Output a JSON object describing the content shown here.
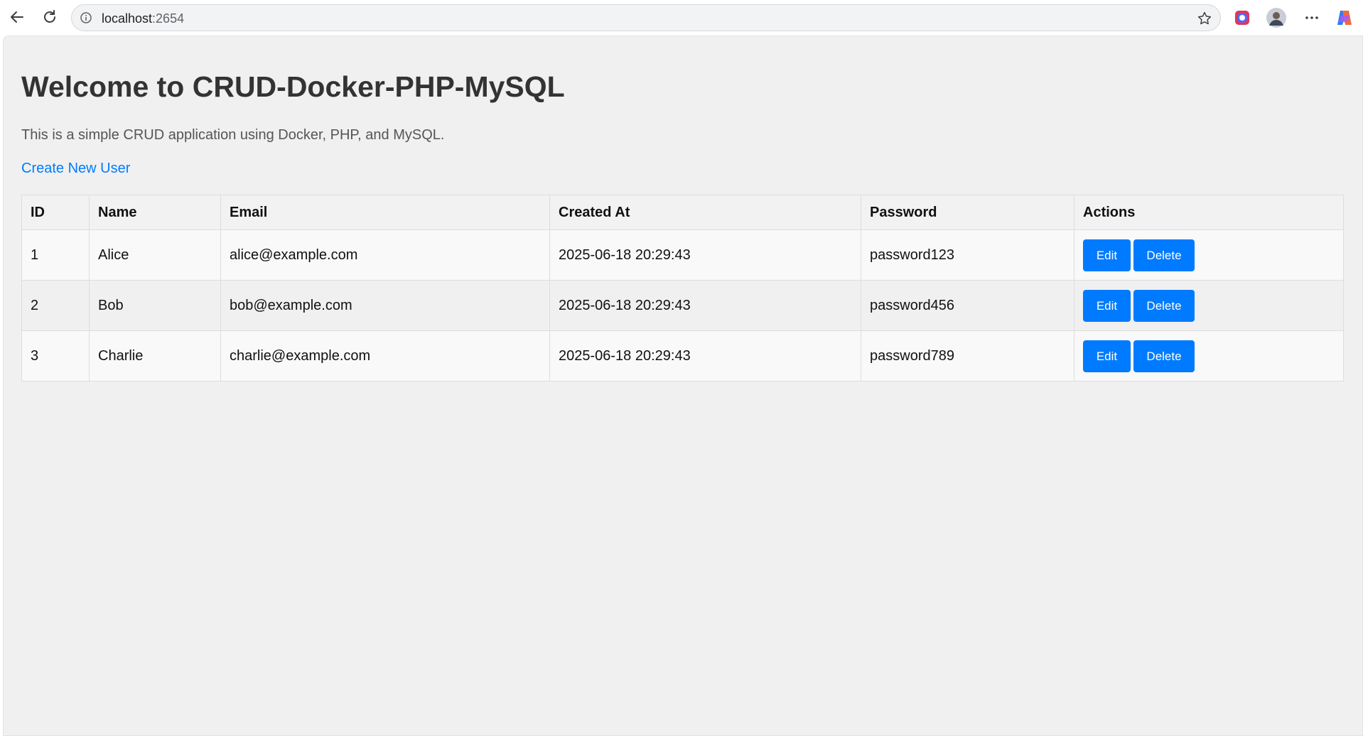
{
  "browser": {
    "url_host": "localhost",
    "url_port": ":2654"
  },
  "page": {
    "title": "Welcome to CRUD-Docker-PHP-MySQL",
    "subtitle": "This is a simple CRUD application using Docker, PHP, and MySQL.",
    "create_link": "Create New User"
  },
  "table": {
    "headers": [
      "ID",
      "Name",
      "Email",
      "Created At",
      "Password",
      "Actions"
    ],
    "rows": [
      {
        "id": "1",
        "name": "Alice",
        "email": "alice@example.com",
        "created_at": "2025-06-18 20:29:43",
        "password": "password123"
      },
      {
        "id": "2",
        "name": "Bob",
        "email": "bob@example.com",
        "created_at": "2025-06-18 20:29:43",
        "password": "password456"
      },
      {
        "id": "3",
        "name": "Charlie",
        "email": "charlie@example.com",
        "created_at": "2025-06-18 20:29:43",
        "password": "password789"
      }
    ],
    "edit_label": "Edit",
    "delete_label": "Delete"
  },
  "colors": {
    "accent": "#007bff",
    "page_bg": "#f0f0f0",
    "heading": "#333333"
  },
  "icons": [
    "back-arrow-icon",
    "reload-icon",
    "site-info-icon",
    "star-icon",
    "extension-icon",
    "avatar",
    "more-icon",
    "copilot-icon"
  ]
}
